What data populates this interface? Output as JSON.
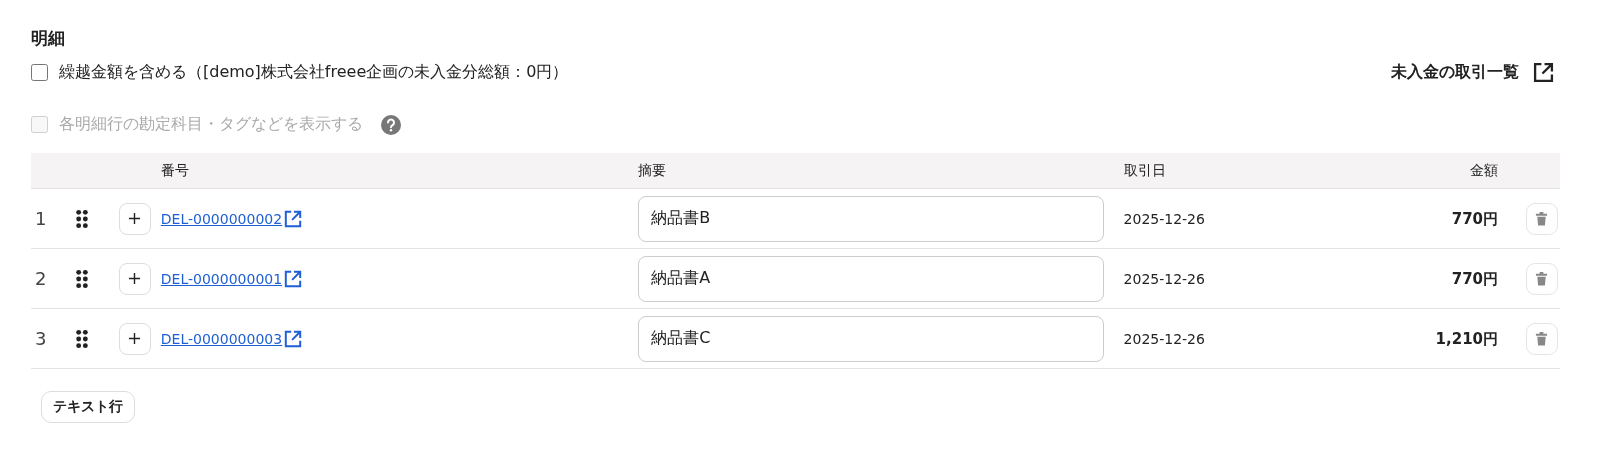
{
  "section_title": "明細",
  "options": [
    {
      "label": "繰越金額を含める（[demo]株式会社freee企画の未入金分総額：0円）",
      "checked": false,
      "disabled": false,
      "help": false
    },
    {
      "label": "各明細行の勘定科目・タグなどを表示する",
      "checked": false,
      "disabled": true,
      "help": true
    }
  ],
  "unpaid_link": "未入金の取引一覧",
  "table": {
    "columns": [
      "番号",
      "摘要",
      "取引日",
      "金額"
    ],
    "rows": [
      {
        "index": "1",
        "number": "DEL-0000000002",
        "summary": "納品書B",
        "date": "2025-12-26",
        "amount": "770円"
      },
      {
        "index": "2",
        "number": "DEL-0000000001",
        "summary": "納品書A",
        "date": "2025-12-26",
        "amount": "770円"
      },
      {
        "index": "3",
        "number": "DEL-0000000003",
        "summary": "納品書C",
        "date": "2025-12-26",
        "amount": "1,210円"
      }
    ]
  },
  "add_text_row_button": "テキスト行"
}
